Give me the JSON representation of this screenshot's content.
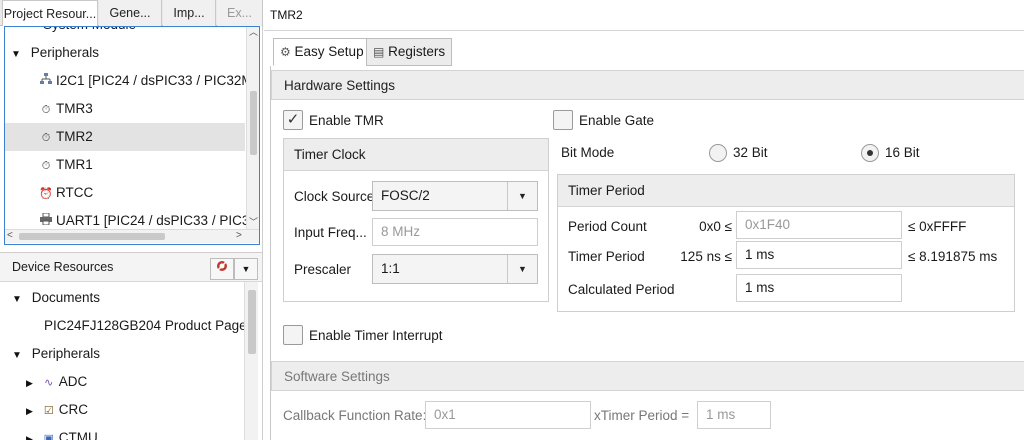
{
  "left_tabs": [
    {
      "label": "Project Resour..."
    },
    {
      "label": "Gene..."
    },
    {
      "label": "Imp..."
    },
    {
      "label": "Ex..."
    }
  ],
  "project_tree": {
    "partial_top": "System Module",
    "peripherals_label": "Peripherals",
    "items": [
      {
        "label": "I2C1 [PIC24 / dsPIC33 / PIC32M",
        "icon": "network-icon"
      },
      {
        "label": "TMR3",
        "icon": "timer-icon"
      },
      {
        "label": "TMR2",
        "icon": "timer-icon",
        "selected": true
      },
      {
        "label": "TMR1",
        "icon": "timer-icon"
      },
      {
        "label": "RTCC",
        "icon": "alarm-clock-icon"
      },
      {
        "label": "UART1 [PIC24 / dsPIC33 / PIC32",
        "icon": "printer-icon"
      }
    ]
  },
  "device_resources": {
    "title": "Device Resources",
    "documents_label": "Documents",
    "product_page": "PIC24FJ128GB204 Product Page",
    "peripherals_label": "Peripherals",
    "items": [
      {
        "label": "ADC",
        "icon": "waveform-icon"
      },
      {
        "label": "CRC",
        "icon": "chip-check-icon"
      },
      {
        "label": "CTMU",
        "icon": "module-icon"
      }
    ]
  },
  "editor": {
    "title": "TMR2",
    "tabs": [
      {
        "label": "Easy Setup",
        "icon": "gear-icon"
      },
      {
        "label": "Registers",
        "icon": "table-icon"
      }
    ],
    "hardware_settings": {
      "title": "Hardware Settings",
      "enable_tmr": "Enable TMR",
      "enable_gate": "Enable Gate",
      "timer_clock": {
        "title": "Timer Clock",
        "clock_source_label": "Clock Source",
        "clock_source_value": "FOSC/2",
        "input_freq_label": "Input Freq...",
        "input_freq_value": "8 MHz",
        "prescaler_label": "Prescaler",
        "prescaler_value": "1:1"
      },
      "bit_mode": {
        "label": "Bit Mode",
        "opt32": "32 Bit",
        "opt16": "16 Bit",
        "selected": "16 Bit"
      },
      "timer_period": {
        "title": "Timer Period",
        "period_count_label": "Period Count",
        "period_count_min": "0x0 ≤",
        "period_count_value": "0x1F40",
        "period_count_max": "≤  0xFFFF",
        "timer_period_label": "Timer Period",
        "timer_period_min": "125 ns ≤",
        "timer_period_value": "1 ms",
        "timer_period_max": "≤  8.191875 ms",
        "calculated_label": "Calculated Period",
        "calculated_value": "1 ms"
      },
      "enable_interrupt": "Enable Timer Interrupt"
    },
    "software_settings": {
      "title": "Software Settings",
      "callback_label": "Callback Function Rate:",
      "callback_value": "0x1",
      "xtimer_label": "xTimer Period =",
      "xtimer_value": "1 ms"
    }
  },
  "colors": {
    "tree_focus_border": "#3b82d6",
    "section_header_bg": "#ededed",
    "selected_row_bg": "#e3e3e3"
  }
}
